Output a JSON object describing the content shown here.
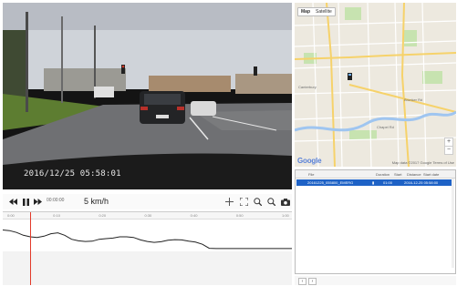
{
  "video": {
    "timestamp": "2016/12/25 05:58:01"
  },
  "player": {
    "speed": "5 km/h",
    "current_time": "00:00:00",
    "controls": [
      "rewind-icon",
      "pause-icon",
      "fast-forward-icon",
      "crosshair-icon",
      "fullscreen-icon",
      "zoom-in-icon",
      "zoom-out-icon",
      "snapshot-icon"
    ]
  },
  "graph": {
    "ruler_ticks": [
      "0:00",
      "0:10",
      "0:20",
      "0:30",
      "0:40",
      "0:50",
      "1:00"
    ],
    "speed_profile": [
      0.72,
      0.7,
      0.64,
      0.55,
      0.5,
      0.48,
      0.52,
      0.6,
      0.63,
      0.55,
      0.42,
      0.37,
      0.35,
      0.36,
      0.42,
      0.44,
      0.46,
      0.5,
      0.5,
      0.48,
      0.4,
      0.35,
      0.32,
      0.34,
      0.39,
      0.41,
      0.4,
      0.36,
      0.33,
      0.26,
      0.13,
      0.12,
      0.12,
      0.12,
      0.12,
      0.12,
      0.12,
      0.12,
      0.12,
      0.12,
      0.12,
      0.12,
      0.12
    ]
  },
  "map": {
    "tabs": [
      {
        "label": "Map"
      },
      {
        "label": "Satellite"
      }
    ],
    "logo": "Google",
    "credit": "Map data ©2017 Google  Terms of Use",
    "zoom_in": "+",
    "zoom_out": "−",
    "streets": [
      "Canterbury",
      "Brunker Rd",
      "Chapel Rd"
    ],
    "accent": "#1e62c6"
  },
  "list": {
    "columns": [
      "File",
      "Duration",
      "Start",
      "Distance",
      "Start date"
    ],
    "rows": [
      {
        "file": "20161225_055800_EMERG",
        "duration": "01:00",
        "start": "2016-12-25 05:58:00"
      }
    ]
  },
  "footer": {
    "buttons": [
      "prev-icon",
      "next-icon"
    ]
  }
}
